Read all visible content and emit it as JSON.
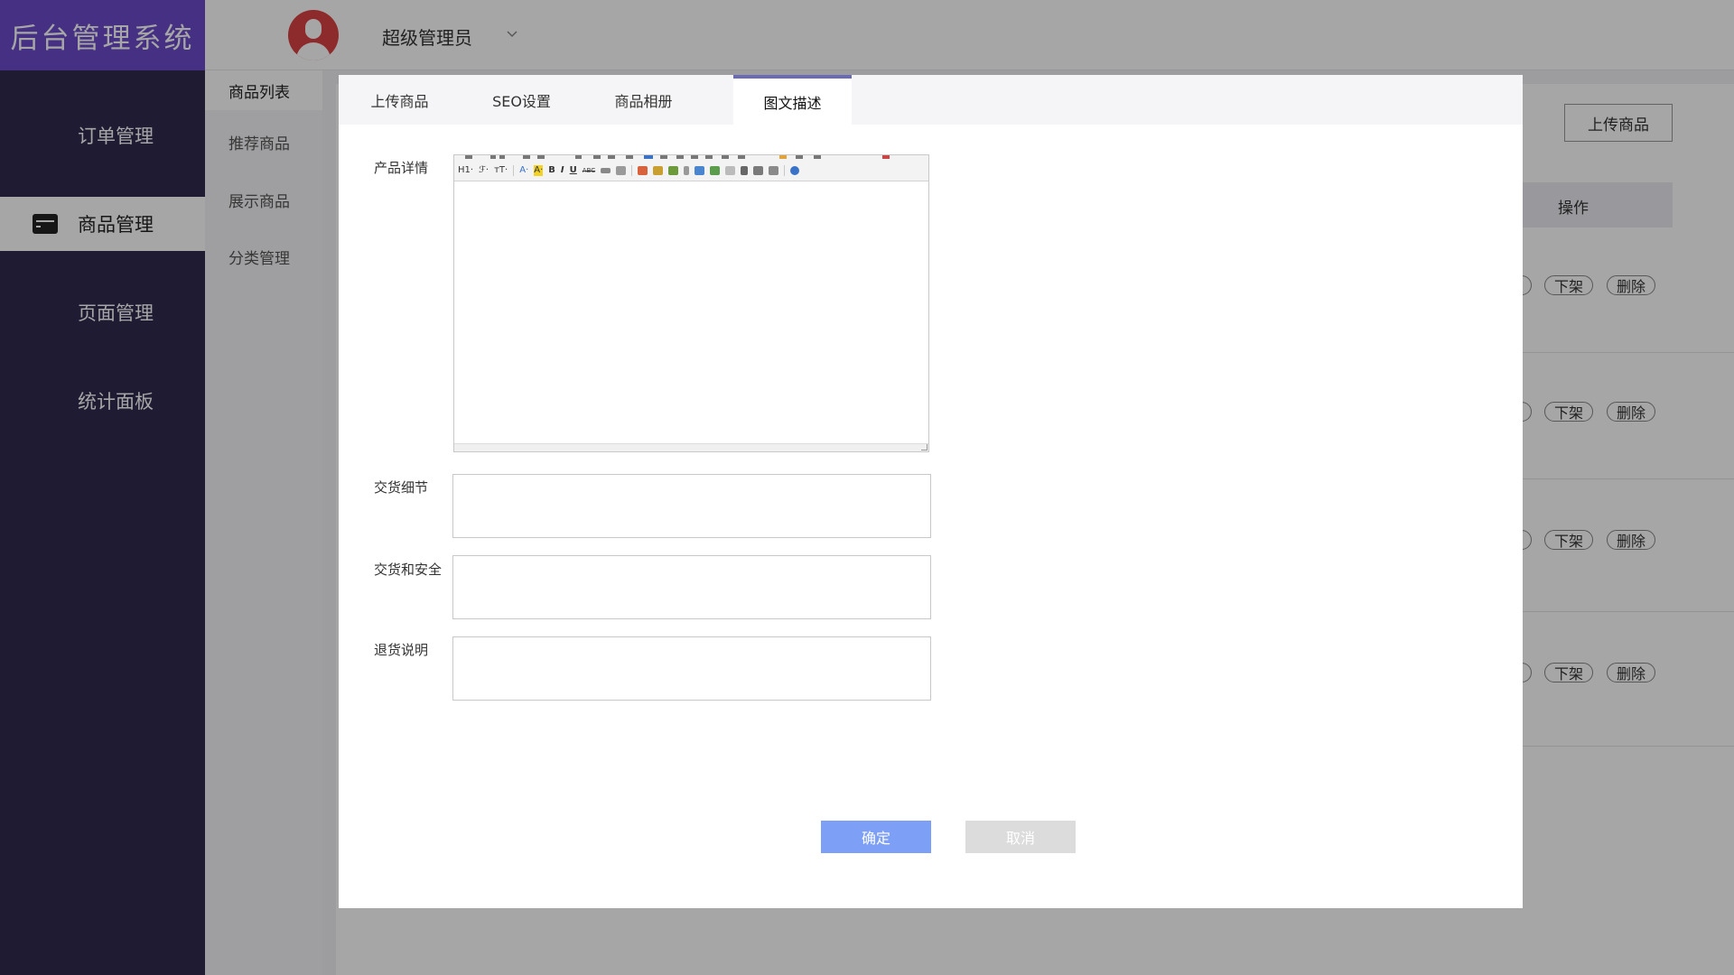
{
  "app": {
    "logo": "后台管理系统"
  },
  "header": {
    "user_name": "超级管理员"
  },
  "sidebar": {
    "items": [
      {
        "label": "订单管理"
      },
      {
        "label": "商品管理"
      },
      {
        "label": "页面管理"
      },
      {
        "label": "统计面板"
      }
    ]
  },
  "subnav": {
    "items": [
      {
        "label": "商品列表"
      },
      {
        "label": "推荐商品"
      },
      {
        "label": "展示商品"
      },
      {
        "label": "分类管理"
      }
    ]
  },
  "page": {
    "upload_button": "上传商品",
    "op_header": "操作",
    "row_actions": {
      "off_shelf": "下架",
      "delete": "删除"
    }
  },
  "modal": {
    "tabs": [
      {
        "label": "上传商品"
      },
      {
        "label": "SEO设置"
      },
      {
        "label": "商品相册"
      },
      {
        "label": "图文描述"
      }
    ],
    "active_tab": "图文描述",
    "fields": {
      "product_detail": "产品详情",
      "delivery_detail": "交货细节",
      "delivery_safety": "交货和安全",
      "return_note": "退货说明"
    },
    "toolbar": {
      "heading": "H1·",
      "font_family": "ℱ·",
      "font_size": "тT·",
      "font_color": "A·",
      "highlight": "A·",
      "bold": "B",
      "italic": "I",
      "underline": "U",
      "strike": "ABC"
    },
    "buttons": {
      "confirm": "确定",
      "cancel": "取消"
    }
  },
  "colors": {
    "brand": "#6b4bc9",
    "sidebar_bg": "#2e2a4f",
    "primary_button": "#7d9ff5",
    "avatar": "#d94143",
    "active_tab_border": "#6b6bb5"
  },
  "icons": [
    "avatar-icon",
    "chevron-down-icon",
    "card-icon",
    "editor-toolbar-icons",
    "help-icon",
    "resize-handle-icon"
  ]
}
